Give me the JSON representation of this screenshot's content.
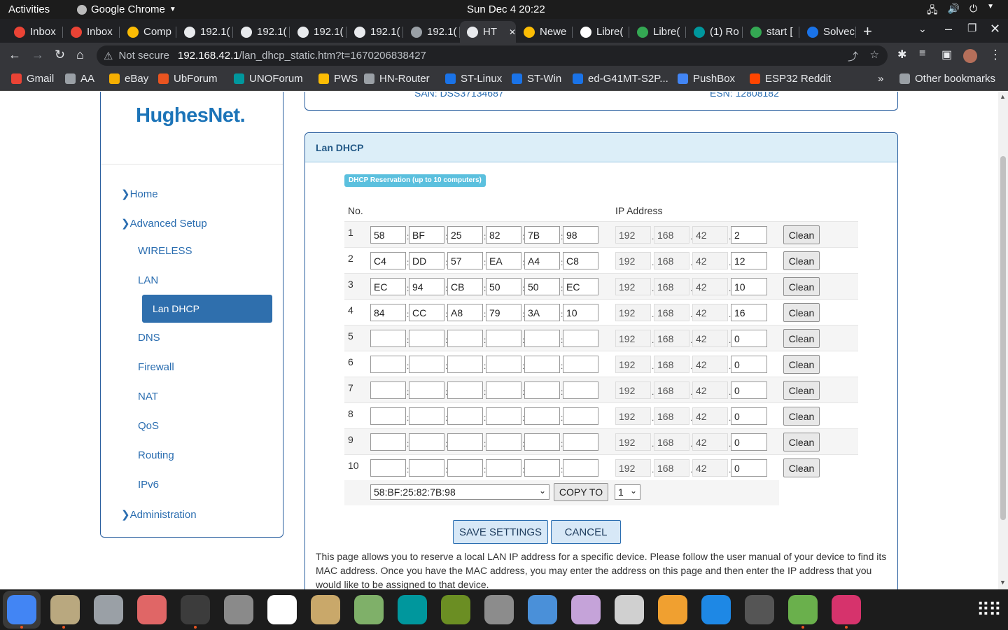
{
  "gnome": {
    "activities": "Activities",
    "app_name": "Google Chrome",
    "clock": "Sun Dec 4  20:22"
  },
  "tabs": [
    {
      "label": "Inbox",
      "color": "#ea4335"
    },
    {
      "label": "Inbox",
      "color": "#ea4335"
    },
    {
      "label": "Comp",
      "color": "#fbbc04"
    },
    {
      "label": "192.1(",
      "color": "#e8eaed"
    },
    {
      "label": "192.1(",
      "color": "#e8eaed"
    },
    {
      "label": "192.1(",
      "color": "#e8eaed"
    },
    {
      "label": "192.1(",
      "color": "#e8eaed"
    },
    {
      "label": "192.1(",
      "color": "#9aa0a6"
    },
    {
      "label": "HT",
      "color": "#e8eaed"
    },
    {
      "label": "Newe",
      "color": "#fbbc04"
    },
    {
      "label": "Libre(",
      "color": "#ffffff"
    },
    {
      "label": "Libre(",
      "color": "#34a853"
    },
    {
      "label": "(1) Ro",
      "color": "#00979d"
    },
    {
      "label": "start [",
      "color": "#34a853"
    },
    {
      "label": "Solvec",
      "color": "#1a73e8"
    }
  ],
  "toolbar": {
    "security": "Not secure",
    "url_host": "192.168.42.1",
    "url_path": "/lan_dhcp_static.htm?t=1670206838427"
  },
  "bookmarks": [
    {
      "label": "Gmail",
      "color": "#ea4335"
    },
    {
      "label": "AA",
      "color": "#9aa0a6"
    },
    {
      "label": "eBay",
      "color": "#f5af02"
    },
    {
      "label": "UbForum",
      "color": "#e95420"
    },
    {
      "label": "UNOForum",
      "color": "#00979d"
    },
    {
      "label": "PWS",
      "color": "#fbbc04"
    },
    {
      "label": "HN-Router",
      "color": "#9aa0a6"
    },
    {
      "label": "ST-Linux",
      "color": "#1a73e8"
    },
    {
      "label": "ST-Win",
      "color": "#1a73e8"
    },
    {
      "label": "ed-G41MT-S2P...",
      "color": "#1a73e8"
    },
    {
      "label": "PushBox",
      "color": "#4285f4"
    },
    {
      "label": "ESP32 Reddit",
      "color": "#ff4500"
    }
  ],
  "other_bookmarks": "Other bookmarks",
  "logo": "HughesNet.",
  "top_info": {
    "san": "SAN: DSS37134687",
    "esn": "ESN: 12808182"
  },
  "nav": {
    "home": "Home",
    "advanced": "Advanced Setup",
    "wireless": "WIRELESS",
    "lan": "LAN",
    "lan_dhcp": "Lan DHCP",
    "dns": "DNS",
    "firewall": "Firewall",
    "nat": "NAT",
    "qos": "QoS",
    "routing": "Routing",
    "ipv6": "IPv6",
    "administration": "Administration"
  },
  "panel": {
    "title": "Lan DHCP",
    "badge": "DHCP Reservation (up to 10 computers)",
    "col_no": "No.",
    "col_ip": "IP Address"
  },
  "rows": [
    {
      "no": "1",
      "mac": [
        "58",
        "BF",
        "25",
        "82",
        "7B",
        "98"
      ],
      "ip": [
        "192",
        "168",
        "42",
        "2"
      ]
    },
    {
      "no": "2",
      "mac": [
        "C4",
        "DD",
        "57",
        "EA",
        "A4",
        "C8"
      ],
      "ip": [
        "192",
        "168",
        "42",
        "12"
      ]
    },
    {
      "no": "3",
      "mac": [
        "EC",
        "94",
        "CB",
        "50",
        "50",
        "EC"
      ],
      "ip": [
        "192",
        "168",
        "42",
        "10"
      ]
    },
    {
      "no": "4",
      "mac": [
        "84",
        "CC",
        "A8",
        "79",
        "3A",
        "10"
      ],
      "ip": [
        "192",
        "168",
        "42",
        "16"
      ]
    },
    {
      "no": "5",
      "mac": [
        "",
        "",
        "",
        "",
        "",
        ""
      ],
      "ip": [
        "192",
        "168",
        "42",
        "0"
      ]
    },
    {
      "no": "6",
      "mac": [
        "",
        "",
        "",
        "",
        "",
        ""
      ],
      "ip": [
        "192",
        "168",
        "42",
        "0"
      ]
    },
    {
      "no": "7",
      "mac": [
        "",
        "",
        "",
        "",
        "",
        ""
      ],
      "ip": [
        "192",
        "168",
        "42",
        "0"
      ]
    },
    {
      "no": "8",
      "mac": [
        "",
        "",
        "",
        "",
        "",
        ""
      ],
      "ip": [
        "192",
        "168",
        "42",
        "0"
      ]
    },
    {
      "no": "9",
      "mac": [
        "",
        "",
        "",
        "",
        "",
        ""
      ],
      "ip": [
        "192",
        "168",
        "42",
        "0"
      ]
    },
    {
      "no": "10",
      "mac": [
        "",
        "",
        "",
        "",
        "",
        ""
      ],
      "ip": [
        "192",
        "168",
        "42",
        "0"
      ]
    }
  ],
  "clean_label": "Clean",
  "copy": {
    "mac_selected": "58:BF:25:82:7B:98",
    "button": "COPY TO",
    "slot_selected": "1"
  },
  "save_label": "SAVE SETTINGS",
  "cancel_label": "CANCEL",
  "description": "This page allows you to reserve a local LAN IP address for a specific device. Please follow the user manual of your device to find its MAC address. Once you have the MAC address, you may enter the address on this page and then enter the IP address that you would like to be assigned to that device.",
  "dock_apps": [
    {
      "name": "chrome",
      "color": "#4285f4"
    },
    {
      "name": "files",
      "color": "#b9a87f"
    },
    {
      "name": "clock",
      "color": "#9aa0a6"
    },
    {
      "name": "disk-usage",
      "color": "#e06666"
    },
    {
      "name": "terminal",
      "color": "#3c3c3c"
    },
    {
      "name": "settings",
      "color": "#8a8a8a"
    },
    {
      "name": "text-editor",
      "color": "#ffffff"
    },
    {
      "name": "archive",
      "color": "#c9a86a"
    },
    {
      "name": "system-monitor",
      "color": "#7fb069"
    },
    {
      "name": "arduino",
      "color": "#00979d"
    },
    {
      "name": "router-app",
      "color": "#6b8e23"
    },
    {
      "name": "camera-app",
      "color": "#8c8c8c"
    },
    {
      "name": "thermometer",
      "color": "#4a90d9"
    },
    {
      "name": "tweaks",
      "color": "#c5a3d9"
    },
    {
      "name": "software",
      "color": "#d0d0d0"
    },
    {
      "name": "calculator",
      "color": "#f0a030"
    },
    {
      "name": "network-app",
      "color": "#1e88e5"
    },
    {
      "name": "maps",
      "color": "#555555"
    },
    {
      "name": "update",
      "color": "#6ab04c"
    },
    {
      "name": "radio",
      "color": "#d6336c"
    }
  ]
}
